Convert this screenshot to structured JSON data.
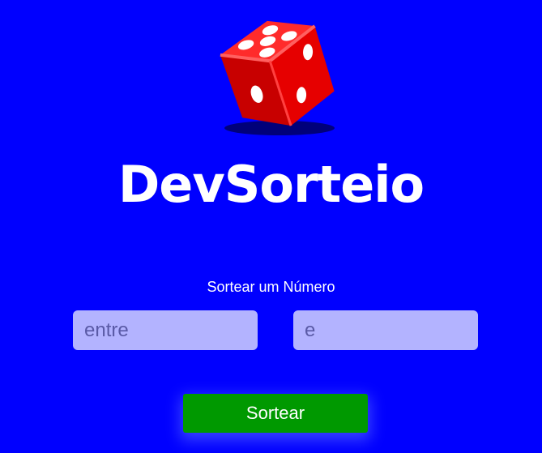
{
  "app": {
    "title": "DevSorteio",
    "logo_icon": "dice-icon",
    "background_color": "#0000ff"
  },
  "form": {
    "heading": "Sortear um Número",
    "from_placeholder": "entre",
    "to_placeholder": "e",
    "submit_label": "Sortear",
    "button_color": "#009900",
    "input_color": "#b3b3ff"
  }
}
